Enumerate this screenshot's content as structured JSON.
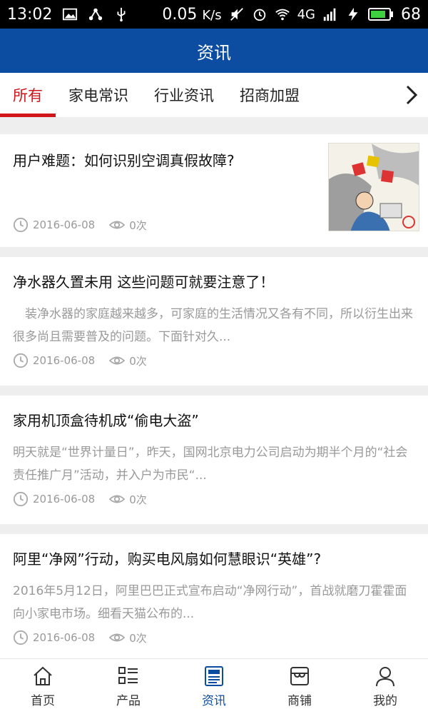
{
  "status": {
    "time": "13:02",
    "network_speed": "0.05",
    "speed_unit": "K/s",
    "signal_label": "4G",
    "battery": "68"
  },
  "header": {
    "title": "资讯"
  },
  "tabs": [
    {
      "label": "所有"
    },
    {
      "label": "家电常识"
    },
    {
      "label": "行业资讯"
    },
    {
      "label": "招商加盟"
    }
  ],
  "articles": [
    {
      "title": "用户难题：如何识别空调真假故障?",
      "summary": "",
      "date": "2016-06-08",
      "views": "0次"
    },
    {
      "title": "净水器久置未用 这些问题可就要注意了！",
      "summary": "　装净水器的家庭越来越多，可家庭的生活情况又各有不同，所以衍生出来很多尚且需要普及的问题。下面针对久...",
      "date": "2016-06-08",
      "views": "0次"
    },
    {
      "title": "家用机顶盒待机成“偷电大盗”",
      "summary": "明天就是“世界计量日”，昨天，国网北京电力公司启动为期半个月的“社会责任推广月”活动，并入户为市民“...",
      "date": "2016-06-08",
      "views": "0次"
    },
    {
      "title": "阿里“净网”行动，购买电风扇如何慧眼识“英雄”?",
      "summary": "2016年5月12日，阿里巴巴正式宣布启动“净网行动”，首战就磨刀霍霍面向小家电市场。细看天猫公布的...",
      "date": "2016-06-08",
      "views": "0次"
    }
  ],
  "bottom_nav": [
    {
      "label": "首页",
      "icon": "home-icon"
    },
    {
      "label": "产品",
      "icon": "list-icon"
    },
    {
      "label": "资讯",
      "icon": "news-icon"
    },
    {
      "label": "商铺",
      "icon": "store-icon"
    },
    {
      "label": "我的",
      "icon": "user-icon"
    }
  ],
  "colors": {
    "primary": "#0c4da2",
    "accent": "#d0151b"
  }
}
